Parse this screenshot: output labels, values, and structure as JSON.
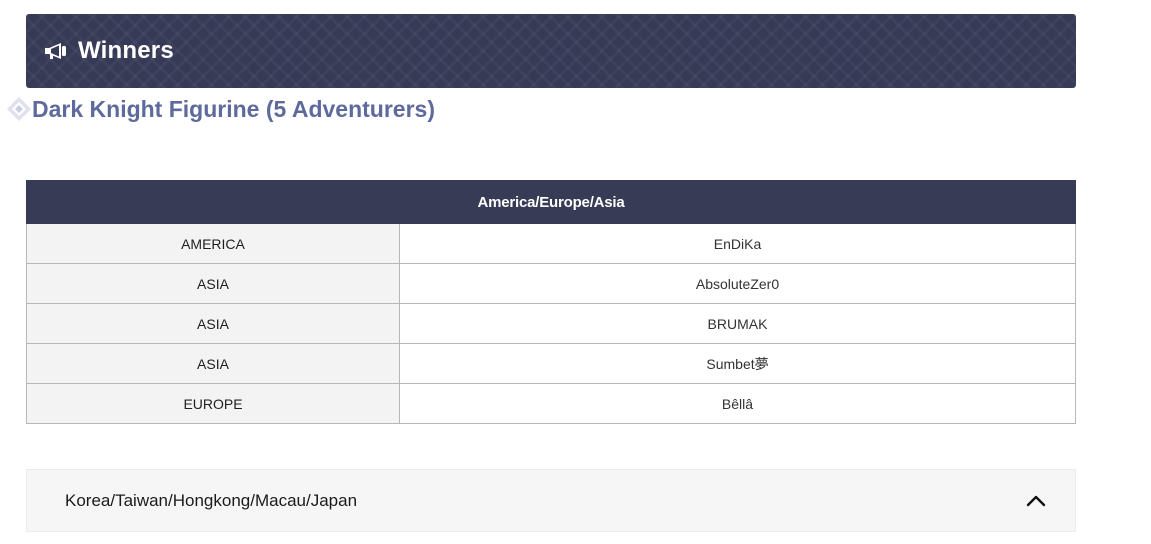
{
  "banner": {
    "icon": "megaphone-icon",
    "title": "Winners",
    "background_color": "#363a56"
  },
  "section": {
    "icon": "diamond-icon",
    "title": "Dark Knight Figurine (5 Adventurers)",
    "title_color": "#5e6a9c"
  },
  "table": {
    "header": "America/Europe/Asia",
    "rows": [
      {
        "region": "AMERICA",
        "winner": "EnDiKa"
      },
      {
        "region": "ASIA",
        "winner": "AbsoluteZer0"
      },
      {
        "region": "ASIA",
        "winner": "BRUMAK"
      },
      {
        "region": "ASIA",
        "winner": "Sumbet夢"
      },
      {
        "region": "EUROPE",
        "winner": "Bêllâ"
      }
    ]
  },
  "accordion": {
    "title": "Korea/Taiwan/Hongkong/Macau/Japan",
    "icon": "chevron-up-icon",
    "expanded": true
  }
}
